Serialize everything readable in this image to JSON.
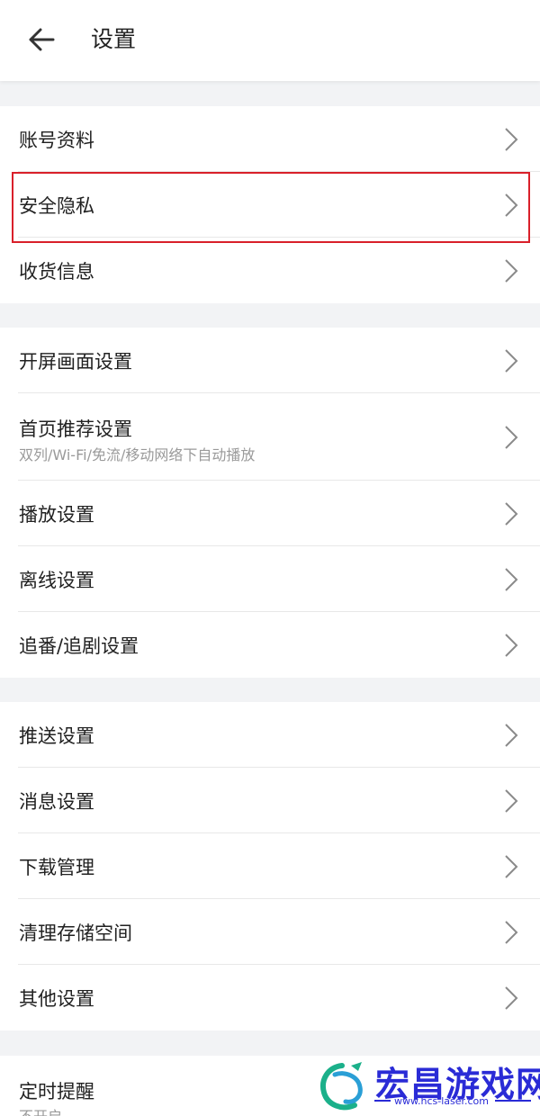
{
  "header": {
    "back_icon": "arrow-left-icon",
    "title": "设置"
  },
  "group1": [
    {
      "label": "账号资料"
    },
    {
      "label": "安全隐私"
    },
    {
      "label": "收货信息"
    }
  ],
  "group2": [
    {
      "label": "开屏画面设置"
    },
    {
      "label": "首页推荐设置",
      "sub": "双列/Wi-Fi/免流/移动网络下自动播放"
    },
    {
      "label": "播放设置"
    },
    {
      "label": "离线设置"
    },
    {
      "label": "追番/追剧设置"
    }
  ],
  "group3": [
    {
      "label": "推送设置"
    },
    {
      "label": "消息设置"
    },
    {
      "label": "下载管理"
    },
    {
      "label": "清理存储空间"
    },
    {
      "label": "其他设置"
    }
  ],
  "group4": [
    {
      "label": "定时提醒",
      "sub": "不开启"
    }
  ],
  "highlight": {
    "item": "安全隐私",
    "color": "#d9202a"
  },
  "watermark": {
    "text": "宏昌游戏网",
    "url": "www.hcs-laser.com",
    "color": "#2a2bd6"
  },
  "colors": {
    "background": "#f2f3f5",
    "card": "#ffffff",
    "text": "#212121",
    "subtext": "#9a9a9a"
  }
}
